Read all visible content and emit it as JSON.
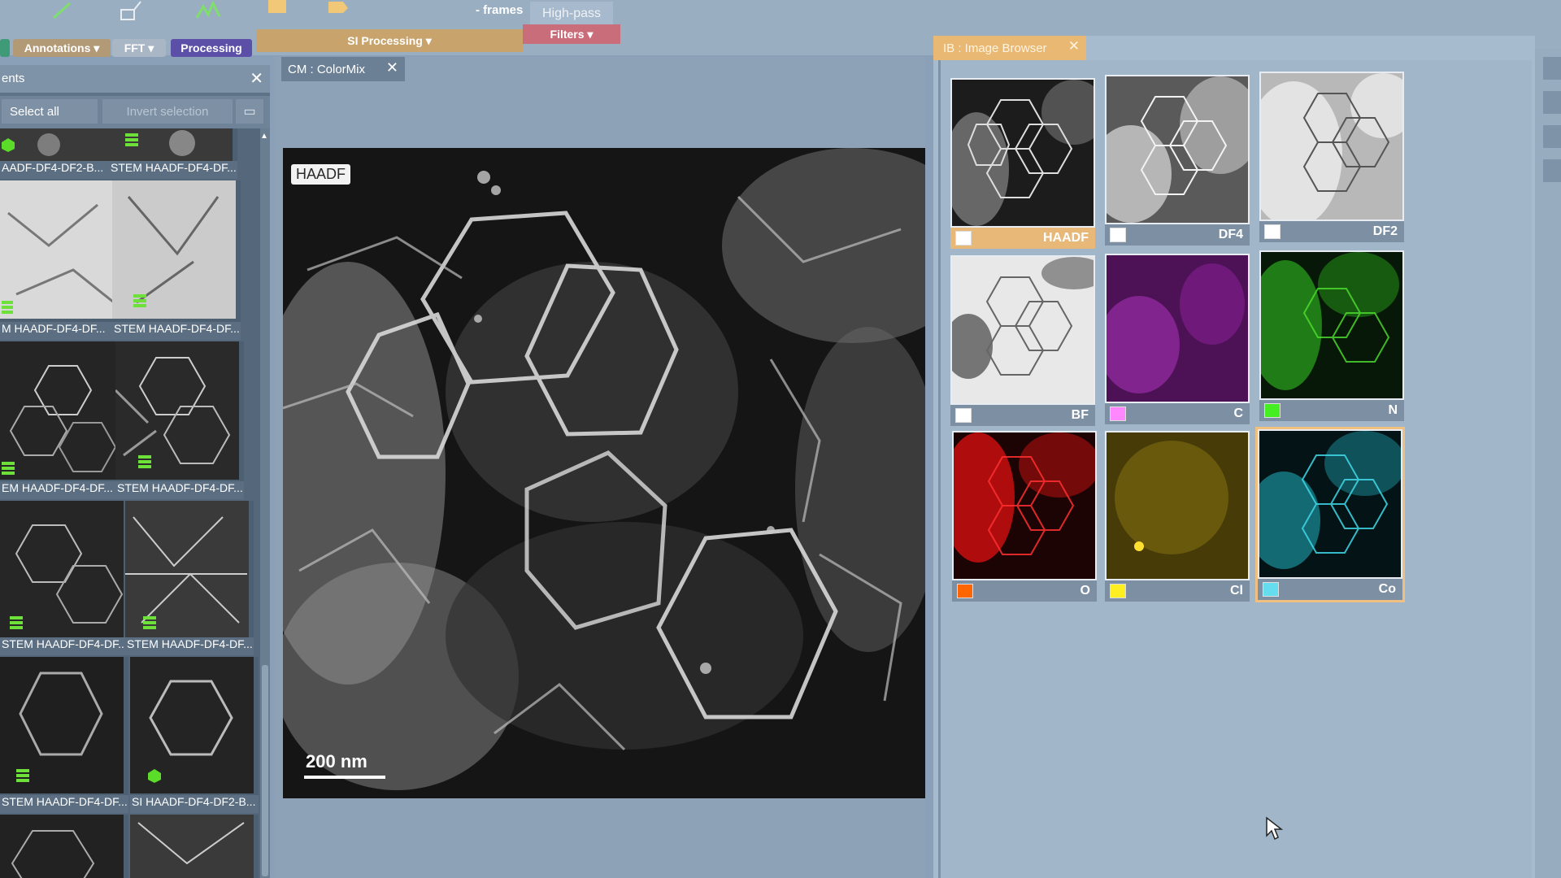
{
  "toolbar": {
    "frames_label": "- frames",
    "highpass_label": "High-pass",
    "menu_annotations": "Annotations ▾",
    "menu_fft": "FFT ▾",
    "menu_processing": "Processing",
    "menu_si_processing": "SI Processing ▾",
    "menu_filters": "Filters ▾"
  },
  "left_panel": {
    "title": "ents",
    "select_all": "Select all",
    "invert_selection": "Invert selection",
    "thumbnails": [
      {
        "caption": "AADF-DF4-DF2-B..."
      },
      {
        "caption": "STEM HAADF-DF4-DF..."
      },
      {
        "caption": "M HAADF-DF4-DF..."
      },
      {
        "caption": "STEM HAADF-DF4-DF..."
      },
      {
        "caption": "EM HAADF-DF4-DF..."
      },
      {
        "caption": "STEM HAADF-DF4-DF..."
      },
      {
        "caption": "STEM HAADF-DF4-DF..."
      },
      {
        "caption": "STEM HAADF-DF4-DF..."
      },
      {
        "caption": "STEM HAADF-DF4-DF..."
      },
      {
        "caption": "SI HAADF-DF4-DF2-B..."
      }
    ]
  },
  "center_panel": {
    "tab_title": "CM : ColorMix",
    "image_label": "HAADF",
    "scale_bar": "200 nm"
  },
  "image_browser": {
    "tab_title": "IB : Image Browser",
    "images": [
      {
        "label": "HAADF",
        "swatch": "#ffffff",
        "selected": false
      },
      {
        "label": "DF4",
        "swatch": "#ffffff",
        "selected": false
      },
      {
        "label": "DF2",
        "swatch": "#ffffff",
        "selected": false
      },
      {
        "label": "BF",
        "swatch": "#ffffff",
        "selected": false
      },
      {
        "label": "C",
        "swatch": "#ff88ff",
        "selected": false
      },
      {
        "label": "N",
        "swatch": "#44ee22",
        "selected": false
      },
      {
        "label": "O",
        "swatch": "#ff6600",
        "selected": false
      },
      {
        "label": "Cl",
        "swatch": "#ffee22",
        "selected": false
      },
      {
        "label": "Co",
        "swatch": "#66ddee",
        "selected": true
      }
    ]
  }
}
